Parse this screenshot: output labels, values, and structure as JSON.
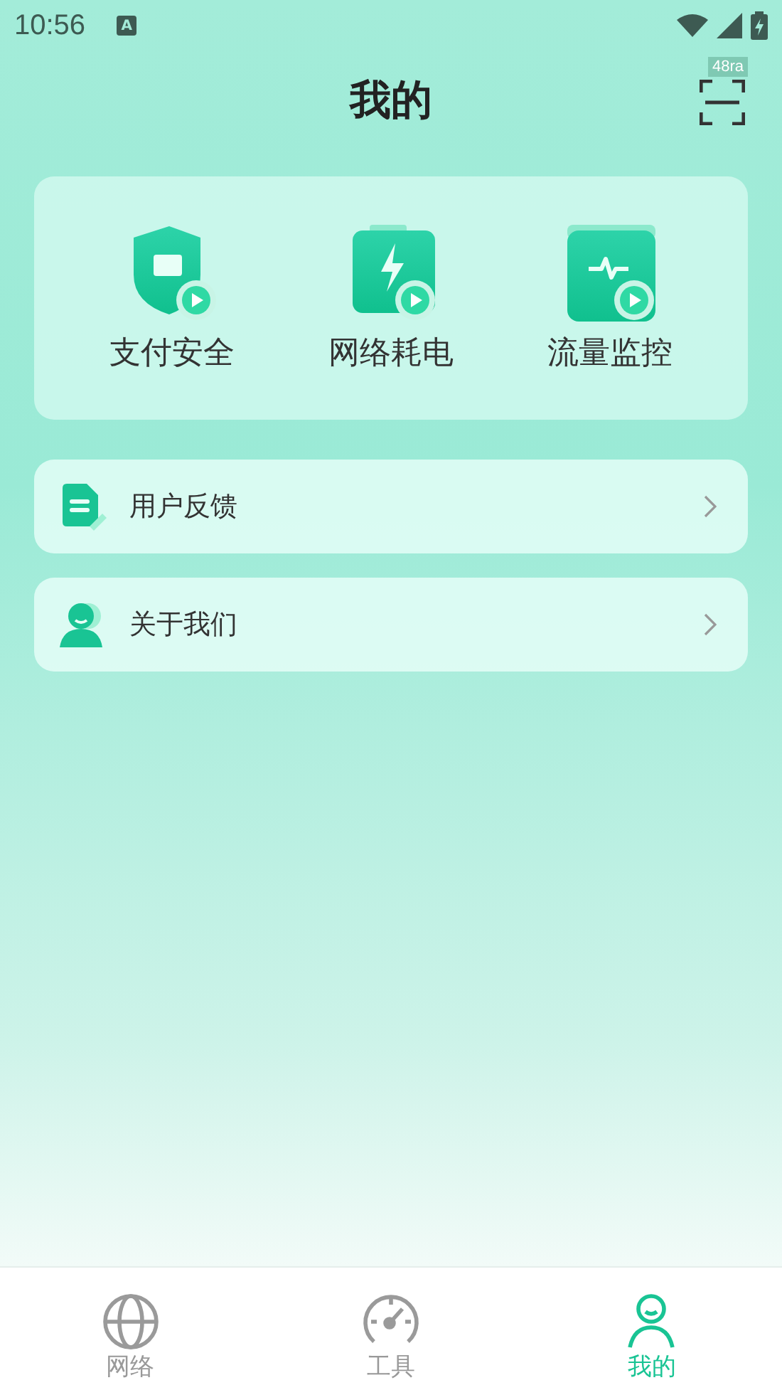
{
  "status_bar": {
    "time": "10:56",
    "badge": "A"
  },
  "header": {
    "title": "我的",
    "scan_badge": "48ra"
  },
  "features": [
    {
      "kind": "shield",
      "label": "支付安全"
    },
    {
      "kind": "battery",
      "label": "网络耗电"
    },
    {
      "kind": "monitor",
      "label": "流量监控"
    }
  ],
  "menu": [
    {
      "kind": "feedback",
      "label": "用户反馈"
    },
    {
      "kind": "about",
      "label": "关于我们"
    }
  ],
  "tabs": [
    {
      "kind": "globe",
      "label": "网络",
      "selected": false
    },
    {
      "kind": "gauge",
      "label": "工具",
      "selected": false
    },
    {
      "kind": "person",
      "label": "我的",
      "selected": true
    }
  ]
}
